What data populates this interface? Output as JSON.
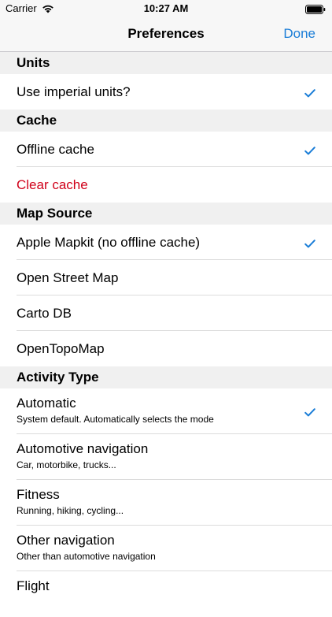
{
  "status_bar": {
    "carrier": "Carrier",
    "time": "10:27 AM"
  },
  "nav": {
    "title": "Preferences",
    "done_label": "Done"
  },
  "accent_color": "#1a7dd7",
  "destructive_color": "#d0021b",
  "sections": {
    "units": {
      "header": "Units",
      "items": [
        {
          "label": "Use imperial units?",
          "checked": true
        }
      ]
    },
    "cache": {
      "header": "Cache",
      "items": [
        {
          "label": "Offline cache",
          "checked": true
        },
        {
          "label": "Clear cache",
          "checked": false
        }
      ]
    },
    "map_source": {
      "header": "Map Source",
      "items": [
        {
          "label": "Apple Mapkit (no offline cache)",
          "checked": true
        },
        {
          "label": "Open Street Map",
          "checked": false
        },
        {
          "label": "Carto DB",
          "checked": false
        },
        {
          "label": "OpenTopoMap",
          "checked": false
        }
      ]
    },
    "activity_type": {
      "header": "Activity Type",
      "items": [
        {
          "label": "Automatic",
          "subtitle": "System default. Automatically selects the mode",
          "checked": true
        },
        {
          "label": "Automotive navigation",
          "subtitle": "Car, motorbike, trucks...",
          "checked": false
        },
        {
          "label": "Fitness",
          "subtitle": "Running, hiking, cycling...",
          "checked": false
        },
        {
          "label": "Other navigation",
          "subtitle": "Other than automotive navigation",
          "checked": false
        },
        {
          "label": "Flight",
          "checked": false
        }
      ]
    }
  }
}
